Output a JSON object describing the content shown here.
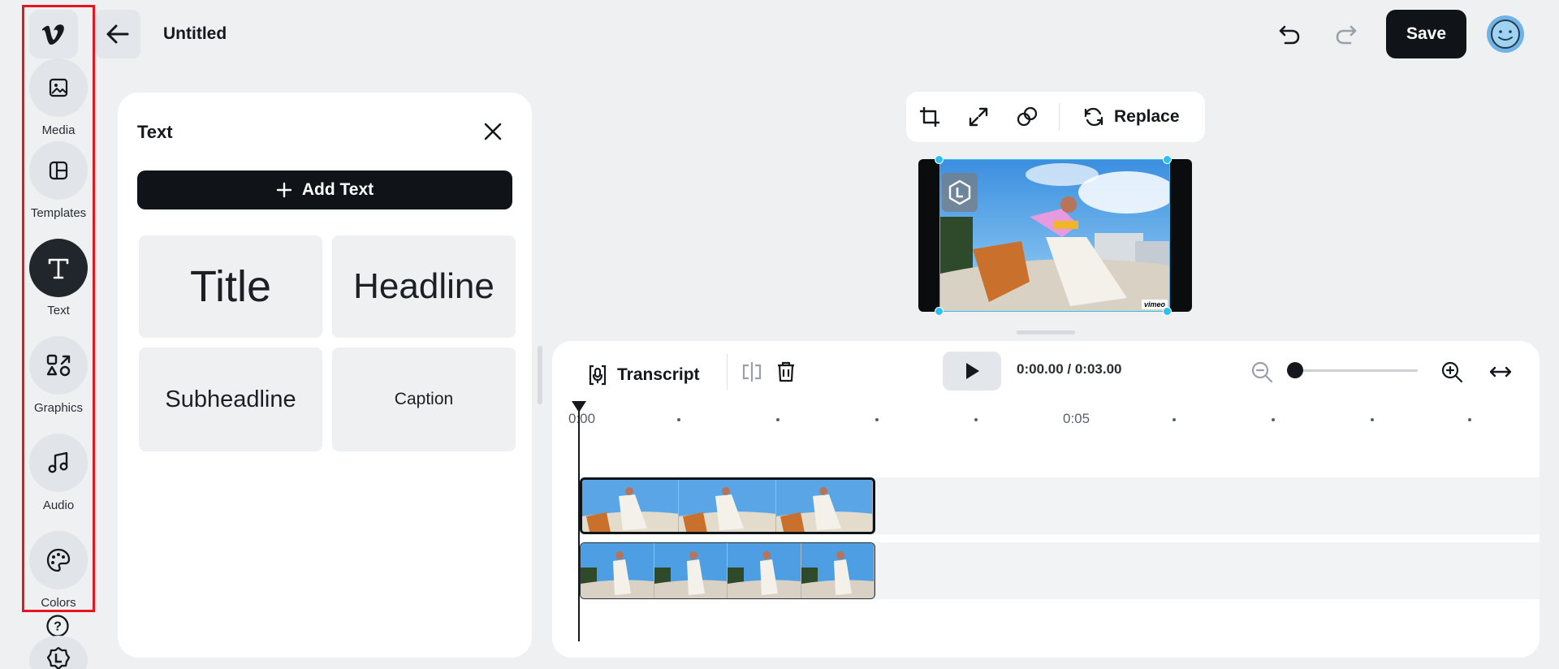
{
  "header": {
    "title": "Untitled",
    "save_label": "Save"
  },
  "sidebar": {
    "items": [
      {
        "label": "Media",
        "icon": "image-icon"
      },
      {
        "label": "Templates",
        "icon": "layout-icon"
      },
      {
        "label": "Text",
        "icon": "text-icon",
        "active": true
      },
      {
        "label": "Graphics",
        "icon": "shapes-icon"
      },
      {
        "label": "Audio",
        "icon": "music-icon"
      },
      {
        "label": "Colors",
        "icon": "palette-icon"
      }
    ],
    "help_glyph": "?"
  },
  "text_panel": {
    "title": "Text",
    "add_text_label": "Add Text",
    "styles": [
      {
        "label": "Title"
      },
      {
        "label": "Headline"
      },
      {
        "label": "Subheadline"
      },
      {
        "label": "Caption"
      }
    ]
  },
  "preview_toolbar": {
    "replace_label": "Replace"
  },
  "preview": {
    "watermark_text": "vimeo"
  },
  "timeline": {
    "transcript_label": "Transcript",
    "timecode": "0:00.00 / 0:03.00",
    "zoom_level": 0,
    "ruler": [
      {
        "label": "0:00"
      },
      {
        "label": "0:05"
      }
    ]
  },
  "colors": {
    "accent_dark": "#101418",
    "selection_blue": "#2cc0ee",
    "highlight_red": "#e8141e"
  }
}
